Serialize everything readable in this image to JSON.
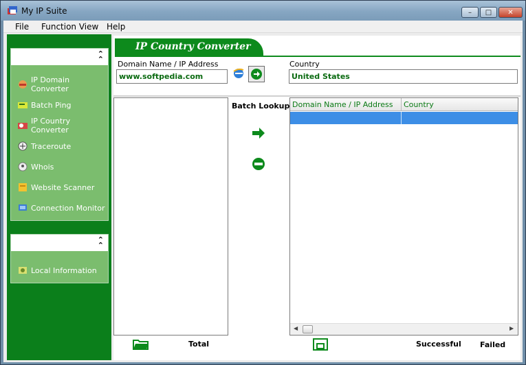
{
  "window": {
    "title": "My IP Suite",
    "controls": {
      "minimize": "–",
      "maximize": "□",
      "close": "✕"
    }
  },
  "menu": [
    "File",
    "Function View",
    "Help"
  ],
  "sidebar": {
    "group1": {
      "items": [
        {
          "label": "IP Domain Converter",
          "icon": "ip-domain-icon"
        },
        {
          "label": "Batch Ping",
          "icon": "batch-ping-icon"
        },
        {
          "label": "IP Country Converter",
          "icon": "ip-country-icon"
        },
        {
          "label": "Traceroute",
          "icon": "traceroute-icon"
        },
        {
          "label": "Whois",
          "icon": "whois-icon"
        },
        {
          "label": "Website Scanner",
          "icon": "website-scanner-icon"
        },
        {
          "label": "Connection Monitor",
          "icon": "connection-monitor-icon"
        }
      ]
    },
    "group2": {
      "items": [
        {
          "label": "Local Information",
          "icon": "local-information-icon"
        }
      ]
    }
  },
  "main": {
    "banner": "IP Country Converter",
    "domain_label": "Domain Name / IP Address",
    "domain_value": "www.softpedia.com",
    "country_label": "Country",
    "country_value": "United States",
    "batch_label": "Batch Lookup",
    "grid_columns": [
      "Domain Name / IP Address",
      "Country"
    ],
    "total_label": "Total",
    "successful_label": "Successful",
    "failed_label": "Failed"
  },
  "colors": {
    "sidebar_green": "#0b7f1b",
    "item_green": "#7bbd6e",
    "accent_green": "#0d8a1c",
    "selection_blue": "#3d8ee6"
  }
}
